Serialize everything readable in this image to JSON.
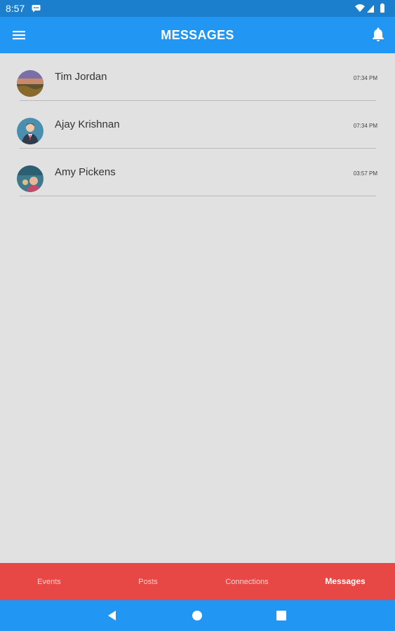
{
  "status_bar": {
    "time": "8:57"
  },
  "app_bar": {
    "title": "MESSAGES"
  },
  "messages": [
    {
      "name": "Tim Jordan",
      "time": "07:34 PM",
      "avatar": "landscape-sunset-avatar"
    },
    {
      "name": "Ajay Krishnan",
      "time": "07:34 PM",
      "avatar": "businessman-avatar"
    },
    {
      "name": "Amy Pickens",
      "time": "03:57 PM",
      "avatar": "person-photo-avatar"
    }
  ],
  "bottom_nav": {
    "items": [
      "Events",
      "Posts",
      "Connections",
      "Messages"
    ],
    "active": "Messages"
  },
  "colors": {
    "status_bar": "#1b7fce",
    "app_bar": "#2196f3",
    "background": "#e1e1e1",
    "bottom_nav": "#e74845",
    "system_nav": "#2196f3"
  }
}
